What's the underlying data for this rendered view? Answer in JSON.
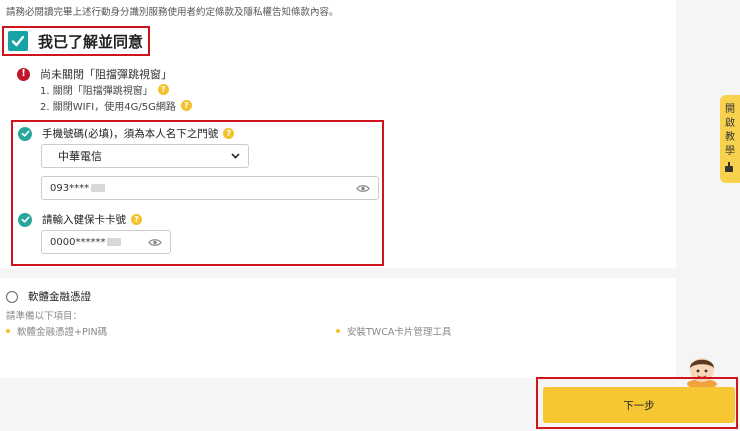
{
  "notice_text": "請務必閱讀完畢上述行動身分識別服務使用者約定條款及隱私權告知條款內容。",
  "agree_label": "我已了解並同意",
  "alert": {
    "title": "尚未關閉「阻擋彈跳視窗」",
    "steps": [
      "1. 關閉「阻擋彈跳視窗」",
      "2. 關閉WIFI，使用4G/5G網路"
    ]
  },
  "phone_field": {
    "label": "手機號碼(必填)，須為本人名下之門號",
    "carrier": "中華電信",
    "number": "093****"
  },
  "card_field": {
    "label": "請輸入健保卡卡號",
    "number": "0000******"
  },
  "cert_option": {
    "label": "軟體金融憑證",
    "prepare": "請準備以下項目：",
    "items": [
      "軟體金融憑證+PIN碼",
      "安裝TWCA卡片管理工具"
    ]
  },
  "side_tab": {
    "chars": [
      "開",
      "啟",
      "教",
      "學"
    ]
  },
  "next_button": "下一步",
  "colors": {
    "accent_yellow": "#f6c633",
    "check_teal": "#17a2a5",
    "ok_green": "#2aa79b",
    "alert_red": "#c0152a",
    "highlight_red": "#d0141e"
  }
}
